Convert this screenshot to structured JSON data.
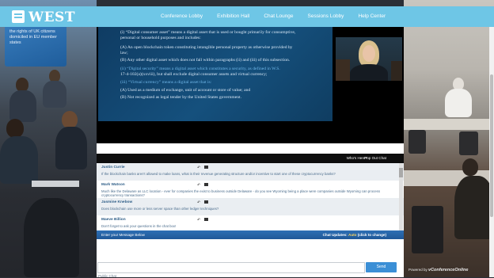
{
  "app": {
    "logo_text": "WEST",
    "logo_icon": "west-logo-icon"
  },
  "nav": {
    "items": [
      "Conference Lobby",
      "Exhibition Hall",
      "Chat Lounge",
      "Sessions Lobby",
      "Help Center"
    ]
  },
  "background": {
    "screen_text": "domiciled in the UK and the rights of UK citizens domiciled in EU member states"
  },
  "slide": {
    "lines": [
      "(i)  “Digital consumer asset” means a digital asset that is used or bought primarily for consumptive,",
      "      personal or household purposes and includes:",
      "      (A)  An open blockchain token constituting intangible personal property as otherwise provided by",
      "      law;",
      "      (B)  Any other digital asset which does not fall within paragraphs (ii) and (iii) of this subsection.",
      "(ii)  “Digital security” means a digital asset which constitutes a security, as defined in W.S.",
      "      17-4-102(a)(xxviii), but shall exclude digital consumer assets and virtual currency;",
      "(iii)  “Virtual currency” means a digital asset that is:",
      "      (A)  Used as a medium of exchange, unit of account or store of value; and",
      "      (B)  Not recognized as legal tender by the United States government."
    ]
  },
  "chat": {
    "whos_here": "Who's Here?",
    "pop_out": "Pop Out Chat",
    "messages": [
      {
        "author": "Justin Currie",
        "text": "If the blockchain banks aren't allowed to make loans, what is their revenue generating structure and/or incentive to start one of these cryptocurrency banks?"
      },
      {
        "author": "Mark Watson",
        "text": "Much like the Delaware as LLC location - ever for companies the exist to business outside Delaware - do you see Wyoming being a place were companies outside Wyoming can process cryptocurrency transactions?"
      },
      {
        "author": "Jasmine Knebow",
        "text": "Does blockchain use more or less server space than other ledger techniques?"
      },
      {
        "author": "Maeve Billion",
        "text": "Don't forget to ask your questions in the chat box!"
      }
    ],
    "enter_message": "Enter your Message Below",
    "updates_label": "Chat Updates:",
    "updates_value": "Auto",
    "updates_hint": "(click to change)",
    "input_value": "",
    "send_label": "Send",
    "public_chat": "Public Chat"
  },
  "footer": {
    "powered_prefix": "Powered by",
    "powered_brand": "vConferenceOnline"
  },
  "colors": {
    "topbar": "#6ec6e6",
    "chat_bar": "#2e6fb4",
    "send_button": "#3b8fd6",
    "author": "#2d5d87"
  }
}
